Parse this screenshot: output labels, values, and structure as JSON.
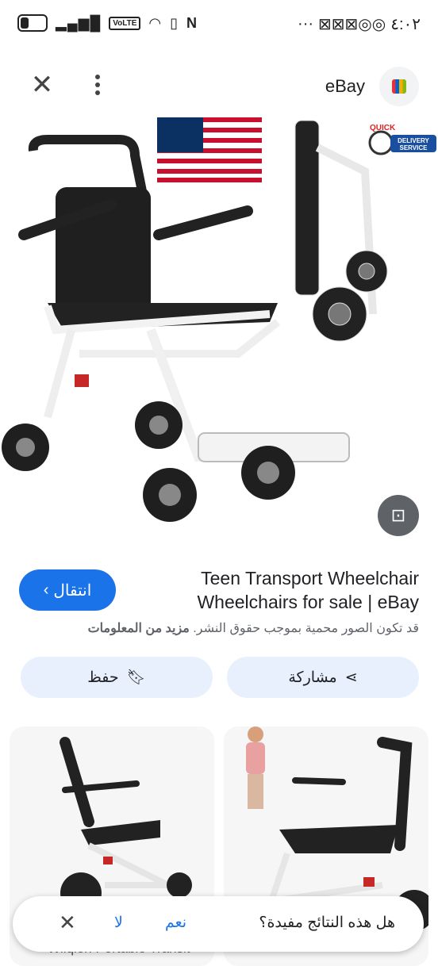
{
  "status_bar": {
    "time": "٤:٠٢",
    "more": "···",
    "volte": "VoLTE",
    "nfc": "N"
  },
  "header": {
    "site_name": "eBay",
    "close_icon": "close-icon",
    "menu_icon": "more-vert-icon"
  },
  "result": {
    "title_line1": "Teen Transport Wheelchair",
    "title_line2": "Wheelchairs for sale | eBay",
    "visit_label": "انتقال",
    "copyright_text": "قد تكون الصور محمية بموجب حقوق النشر.",
    "learn_more": "مزيد من المعلومات",
    "share_label": "مشاركة",
    "save_label": "حفظ"
  },
  "image_badges": {
    "quick": "QUICK",
    "delivery": "DELIVERY",
    "service": "SERVICE"
  },
  "feedback": {
    "question": "هل هذه النتائج مفيدة؟",
    "yes": "نعم",
    "no": "لا"
  },
  "related": {
    "partial_caption": "Wilqion Portable Transit"
  },
  "colors": {
    "accent": "#1a73e8",
    "chip_bg": "#e8f0fe"
  }
}
